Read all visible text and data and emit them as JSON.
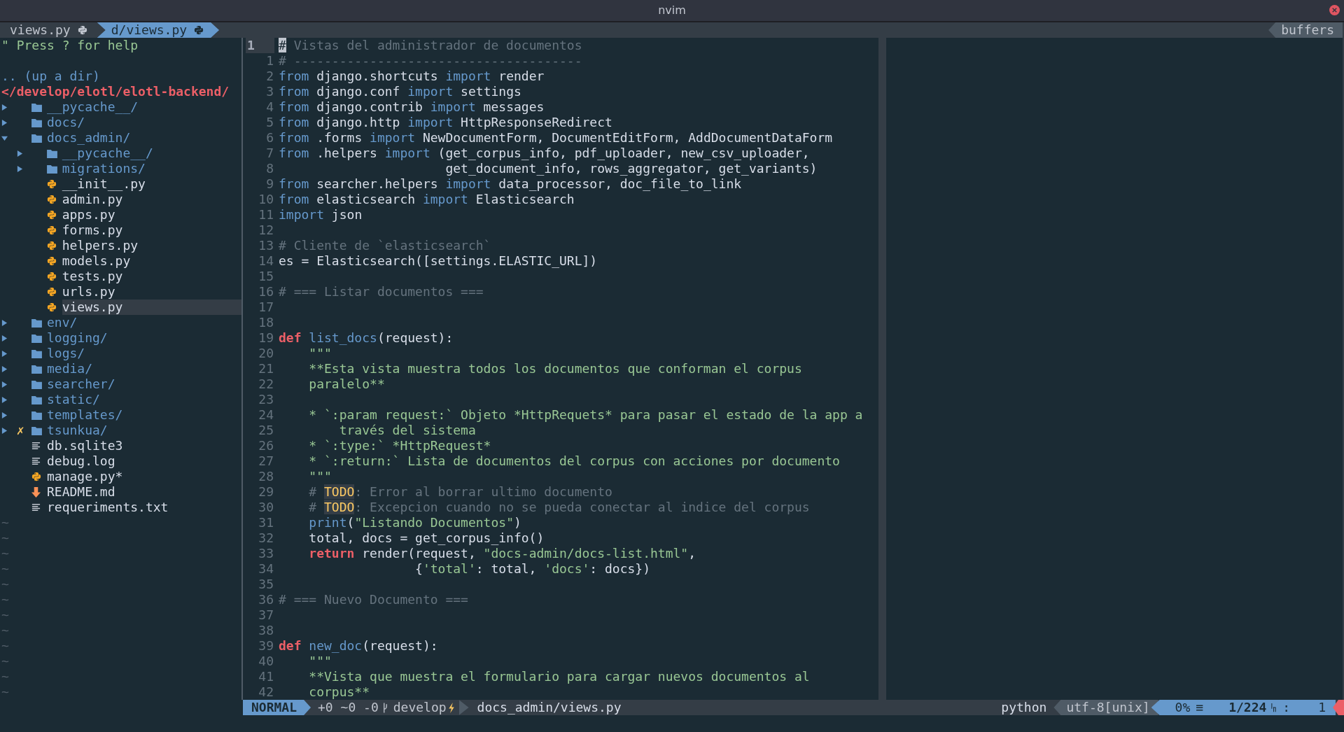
{
  "window": {
    "title": "nvim"
  },
  "tabline": {
    "tabs": [
      {
        "label": "views.py",
        "selected": false
      },
      {
        "label": "d/views.py",
        "selected": true
      }
    ],
    "buffers_label": "buffers"
  },
  "tree": {
    "help": "\" Press ? for help",
    "up": ".. (up a dir)",
    "root": "</develop/elotl/elotl-backend/",
    "items": [
      {
        "name": "__pycache__/",
        "kind": "folder",
        "expanded": false,
        "selected": false
      },
      {
        "name": "docs/",
        "kind": "folder",
        "expanded": false,
        "selected": false
      },
      {
        "name": "docs_admin/",
        "kind": "folder",
        "expanded": true,
        "selected": false,
        "children": [
          {
            "name": "__pycache__/",
            "kind": "folder",
            "expanded": false,
            "selected": false
          },
          {
            "name": "migrations/",
            "kind": "folder",
            "expanded": false,
            "selected": false
          },
          {
            "name": "__init__.py",
            "kind": "python",
            "selected": false
          },
          {
            "name": "admin.py",
            "kind": "python",
            "selected": false
          },
          {
            "name": "apps.py",
            "kind": "python",
            "selected": false
          },
          {
            "name": "forms.py",
            "kind": "python",
            "selected": false
          },
          {
            "name": "helpers.py",
            "kind": "python",
            "selected": false
          },
          {
            "name": "models.py",
            "kind": "python",
            "selected": false
          },
          {
            "name": "tests.py",
            "kind": "python",
            "selected": false
          },
          {
            "name": "urls.py",
            "kind": "python",
            "selected": false
          },
          {
            "name": "views.py",
            "kind": "python",
            "selected": true
          }
        ]
      },
      {
        "name": "env/",
        "kind": "folder",
        "expanded": false,
        "selected": false
      },
      {
        "name": "logging/",
        "kind": "folder",
        "expanded": false,
        "selected": false
      },
      {
        "name": "logs/",
        "kind": "folder",
        "expanded": false,
        "selected": false
      },
      {
        "name": "media/",
        "kind": "folder",
        "expanded": false,
        "selected": false
      },
      {
        "name": "searcher/",
        "kind": "folder",
        "expanded": false,
        "selected": false
      },
      {
        "name": "static/",
        "kind": "folder",
        "expanded": false,
        "selected": false
      },
      {
        "name": "templates/",
        "kind": "folder",
        "expanded": false,
        "selected": false
      },
      {
        "name": "tsunkua/",
        "kind": "folder",
        "expanded": false,
        "selected": false,
        "git_mark": "✗"
      },
      {
        "name": "db.sqlite3",
        "kind": "text",
        "selected": false
      },
      {
        "name": "debug.log",
        "kind": "text",
        "selected": false
      },
      {
        "name": "manage.py*",
        "kind": "python",
        "selected": false
      },
      {
        "name": "README.md",
        "kind": "markdown",
        "selected": false
      },
      {
        "name": "requeriments.txt",
        "kind": "text",
        "selected": false
      }
    ],
    "filler": [
      "~",
      "~",
      "~",
      "~",
      "~",
      "~",
      "~",
      "~",
      "~",
      "~",
      "~",
      "~"
    ]
  },
  "code_lines": [
    {
      "number": "1",
      "current": true,
      "segments": [
        {
          "kind": "cursor",
          "text": "#"
        },
        {
          "kind": "comment",
          "text": " Vistas del administrador de documentos"
        }
      ]
    },
    {
      "number": "1",
      "current": false,
      "segments": [
        {
          "kind": "comment",
          "text": "# --------------------------------------"
        }
      ]
    },
    {
      "number": "2",
      "current": false,
      "segments": [
        {
          "kind": "kw",
          "text": "from"
        },
        {
          "kind": "plain",
          "text": " django.shortcuts "
        },
        {
          "kind": "kw",
          "text": "import"
        },
        {
          "kind": "plain",
          "text": " render"
        }
      ]
    },
    {
      "number": "3",
      "current": false,
      "segments": [
        {
          "kind": "kw",
          "text": "from"
        },
        {
          "kind": "plain",
          "text": " django.conf "
        },
        {
          "kind": "kw",
          "text": "import"
        },
        {
          "kind": "plain",
          "text": " settings"
        }
      ]
    },
    {
      "number": "4",
      "current": false,
      "segments": [
        {
          "kind": "kw",
          "text": "from"
        },
        {
          "kind": "plain",
          "text": " django.contrib "
        },
        {
          "kind": "kw",
          "text": "import"
        },
        {
          "kind": "plain",
          "text": " messages"
        }
      ]
    },
    {
      "number": "5",
      "current": false,
      "segments": [
        {
          "kind": "kw",
          "text": "from"
        },
        {
          "kind": "plain",
          "text": " django.http "
        },
        {
          "kind": "kw",
          "text": "import"
        },
        {
          "kind": "plain",
          "text": " HttpResponseRedirect"
        }
      ]
    },
    {
      "number": "6",
      "current": false,
      "segments": [
        {
          "kind": "kw",
          "text": "from"
        },
        {
          "kind": "plain",
          "text": " .forms "
        },
        {
          "kind": "kw",
          "text": "import"
        },
        {
          "kind": "plain",
          "text": " NewDocumentForm, DocumentEditForm, AddDocumentDataForm"
        }
      ]
    },
    {
      "number": "7",
      "current": false,
      "segments": [
        {
          "kind": "kw",
          "text": "from"
        },
        {
          "kind": "plain",
          "text": " .helpers "
        },
        {
          "kind": "kw",
          "text": "import"
        },
        {
          "kind": "plain",
          "text": " (get_corpus_info, pdf_uploader, new_csv_uploader,"
        }
      ]
    },
    {
      "number": "8",
      "current": false,
      "segments": [
        {
          "kind": "plain",
          "text": "                      get_document_info, rows_aggregator, get_variants)"
        }
      ]
    },
    {
      "number": "9",
      "current": false,
      "segments": [
        {
          "kind": "kw",
          "text": "from"
        },
        {
          "kind": "plain",
          "text": " searcher.helpers "
        },
        {
          "kind": "kw",
          "text": "import"
        },
        {
          "kind": "plain",
          "text": " data_processor, doc_file_to_link"
        }
      ]
    },
    {
      "number": "10",
      "current": false,
      "segments": [
        {
          "kind": "kw",
          "text": "from"
        },
        {
          "kind": "plain",
          "text": " elasticsearch "
        },
        {
          "kind": "kw",
          "text": "import"
        },
        {
          "kind": "plain",
          "text": " Elasticsearch"
        }
      ]
    },
    {
      "number": "11",
      "current": false,
      "segments": [
        {
          "kind": "kw",
          "text": "import"
        },
        {
          "kind": "plain",
          "text": " json"
        }
      ]
    },
    {
      "number": "12",
      "current": false
    },
    {
      "number": "13",
      "current": false,
      "segments": [
        {
          "kind": "comment",
          "text": "# Cliente de `elasticsearch`"
        }
      ]
    },
    {
      "number": "14",
      "current": false,
      "segments": [
        {
          "kind": "plain",
          "text": "es = Elasticsearch([settings.ELASTIC_URL])"
        }
      ]
    },
    {
      "number": "15",
      "current": false
    },
    {
      "number": "16",
      "current": false,
      "segments": [
        {
          "kind": "comment",
          "text": "# === Listar documentos ==="
        }
      ]
    },
    {
      "number": "17",
      "current": false
    },
    {
      "number": "18",
      "current": false
    },
    {
      "number": "19",
      "current": false,
      "segments": [
        {
          "kind": "def",
          "text": "def"
        },
        {
          "kind": "fn",
          "text": " list_docs"
        },
        {
          "kind": "plain",
          "text": "(request):"
        }
      ]
    },
    {
      "number": "20",
      "current": false,
      "segments": [
        {
          "kind": "str",
          "text": "    \"\"\""
        }
      ]
    },
    {
      "number": "21",
      "current": false,
      "segments": [
        {
          "kind": "str",
          "text": "    **Esta vista muestra todos los documentos que conforman el corpus"
        }
      ]
    },
    {
      "number": "22",
      "current": false,
      "segments": [
        {
          "kind": "str",
          "text": "    paralelo**"
        }
      ]
    },
    {
      "number": "23",
      "current": false
    },
    {
      "number": "24",
      "current": false,
      "segments": [
        {
          "kind": "str",
          "text": "    * `:param request:` Objeto *HttpRequets* para pasar el estado de la app a"
        }
      ]
    },
    {
      "number": "25",
      "current": false,
      "segments": [
        {
          "kind": "str",
          "text": "        través del sistema"
        }
      ]
    },
    {
      "number": "26",
      "current": false,
      "segments": [
        {
          "kind": "str",
          "text": "    * `:type:` *HttpRequest*"
        }
      ]
    },
    {
      "number": "27",
      "current": false,
      "segments": [
        {
          "kind": "str",
          "text": "    * `:return:` Lista de documentos del corpus con acciones por documento"
        }
      ]
    },
    {
      "number": "28",
      "current": false,
      "segments": [
        {
          "kind": "str",
          "text": "    \"\"\""
        }
      ]
    },
    {
      "number": "29",
      "current": false,
      "segments": [
        {
          "kind": "comment",
          "text": "    # "
        },
        {
          "kind": "todo",
          "text": "TODO"
        },
        {
          "kind": "comment",
          "text": ": Error al borrar ultimo documento"
        }
      ]
    },
    {
      "number": "30",
      "current": false,
      "segments": [
        {
          "kind": "comment",
          "text": "    # "
        },
        {
          "kind": "todo",
          "text": "TODO"
        },
        {
          "kind": "comment",
          "text": ": Excepcion cuando no se pueda conectar al indice del corpus"
        }
      ]
    },
    {
      "number": "31",
      "current": false,
      "segments": [
        {
          "kind": "kw",
          "text": "    print"
        },
        {
          "kind": "plain",
          "text": "("
        },
        {
          "kind": "str",
          "text": "\"Listando Documentos\""
        },
        {
          "kind": "plain",
          "text": ")"
        }
      ]
    },
    {
      "number": "32",
      "current": false,
      "segments": [
        {
          "kind": "plain",
          "text": "    total, docs = get_corpus_info()"
        }
      ]
    },
    {
      "number": "33",
      "current": false,
      "segments": [
        {
          "kind": "def",
          "text": "    return"
        },
        {
          "kind": "plain",
          "text": " render(request, "
        },
        {
          "kind": "str",
          "text": "\"docs-admin/docs-list.html\""
        },
        {
          "kind": "plain",
          "text": ","
        }
      ]
    },
    {
      "number": "34",
      "current": false,
      "segments": [
        {
          "kind": "plain",
          "text": "                  {"
        },
        {
          "kind": "str",
          "text": "'total'"
        },
        {
          "kind": "plain",
          "text": ": total, "
        },
        {
          "kind": "str",
          "text": "'docs'"
        },
        {
          "kind": "plain",
          "text": ": docs})"
        }
      ]
    },
    {
      "number": "35",
      "current": false
    },
    {
      "number": "36",
      "current": false,
      "segments": [
        {
          "kind": "comment",
          "text": "# === Nuevo Documento ==="
        }
      ]
    },
    {
      "number": "37",
      "current": false
    },
    {
      "number": "38",
      "current": false
    },
    {
      "number": "39",
      "current": false,
      "segments": [
        {
          "kind": "def",
          "text": "def"
        },
        {
          "kind": "fn",
          "text": " new_doc"
        },
        {
          "kind": "plain",
          "text": "(request):"
        }
      ]
    },
    {
      "number": "40",
      "current": false,
      "segments": [
        {
          "kind": "str",
          "text": "    \"\"\""
        }
      ]
    },
    {
      "number": "41",
      "current": false,
      "segments": [
        {
          "kind": "str",
          "text": "    **Vista que muestra el formulario para cargar nuevos documentos al"
        }
      ]
    },
    {
      "number": "42",
      "current": false,
      "segments": [
        {
          "kind": "str",
          "text": "    corpus**"
        }
      ]
    }
  ],
  "status_bar": {
    "mode": "NORMAL",
    "hunks": "+0 ~0 -0",
    "branch": "develop",
    "file": "docs_admin/views.py",
    "filetype": "python",
    "encoding": "utf-8[unix]",
    "percent": "0%",
    "lines_glyph": "≡",
    "position": "1/224",
    "separator": ":",
    "column": "1"
  }
}
